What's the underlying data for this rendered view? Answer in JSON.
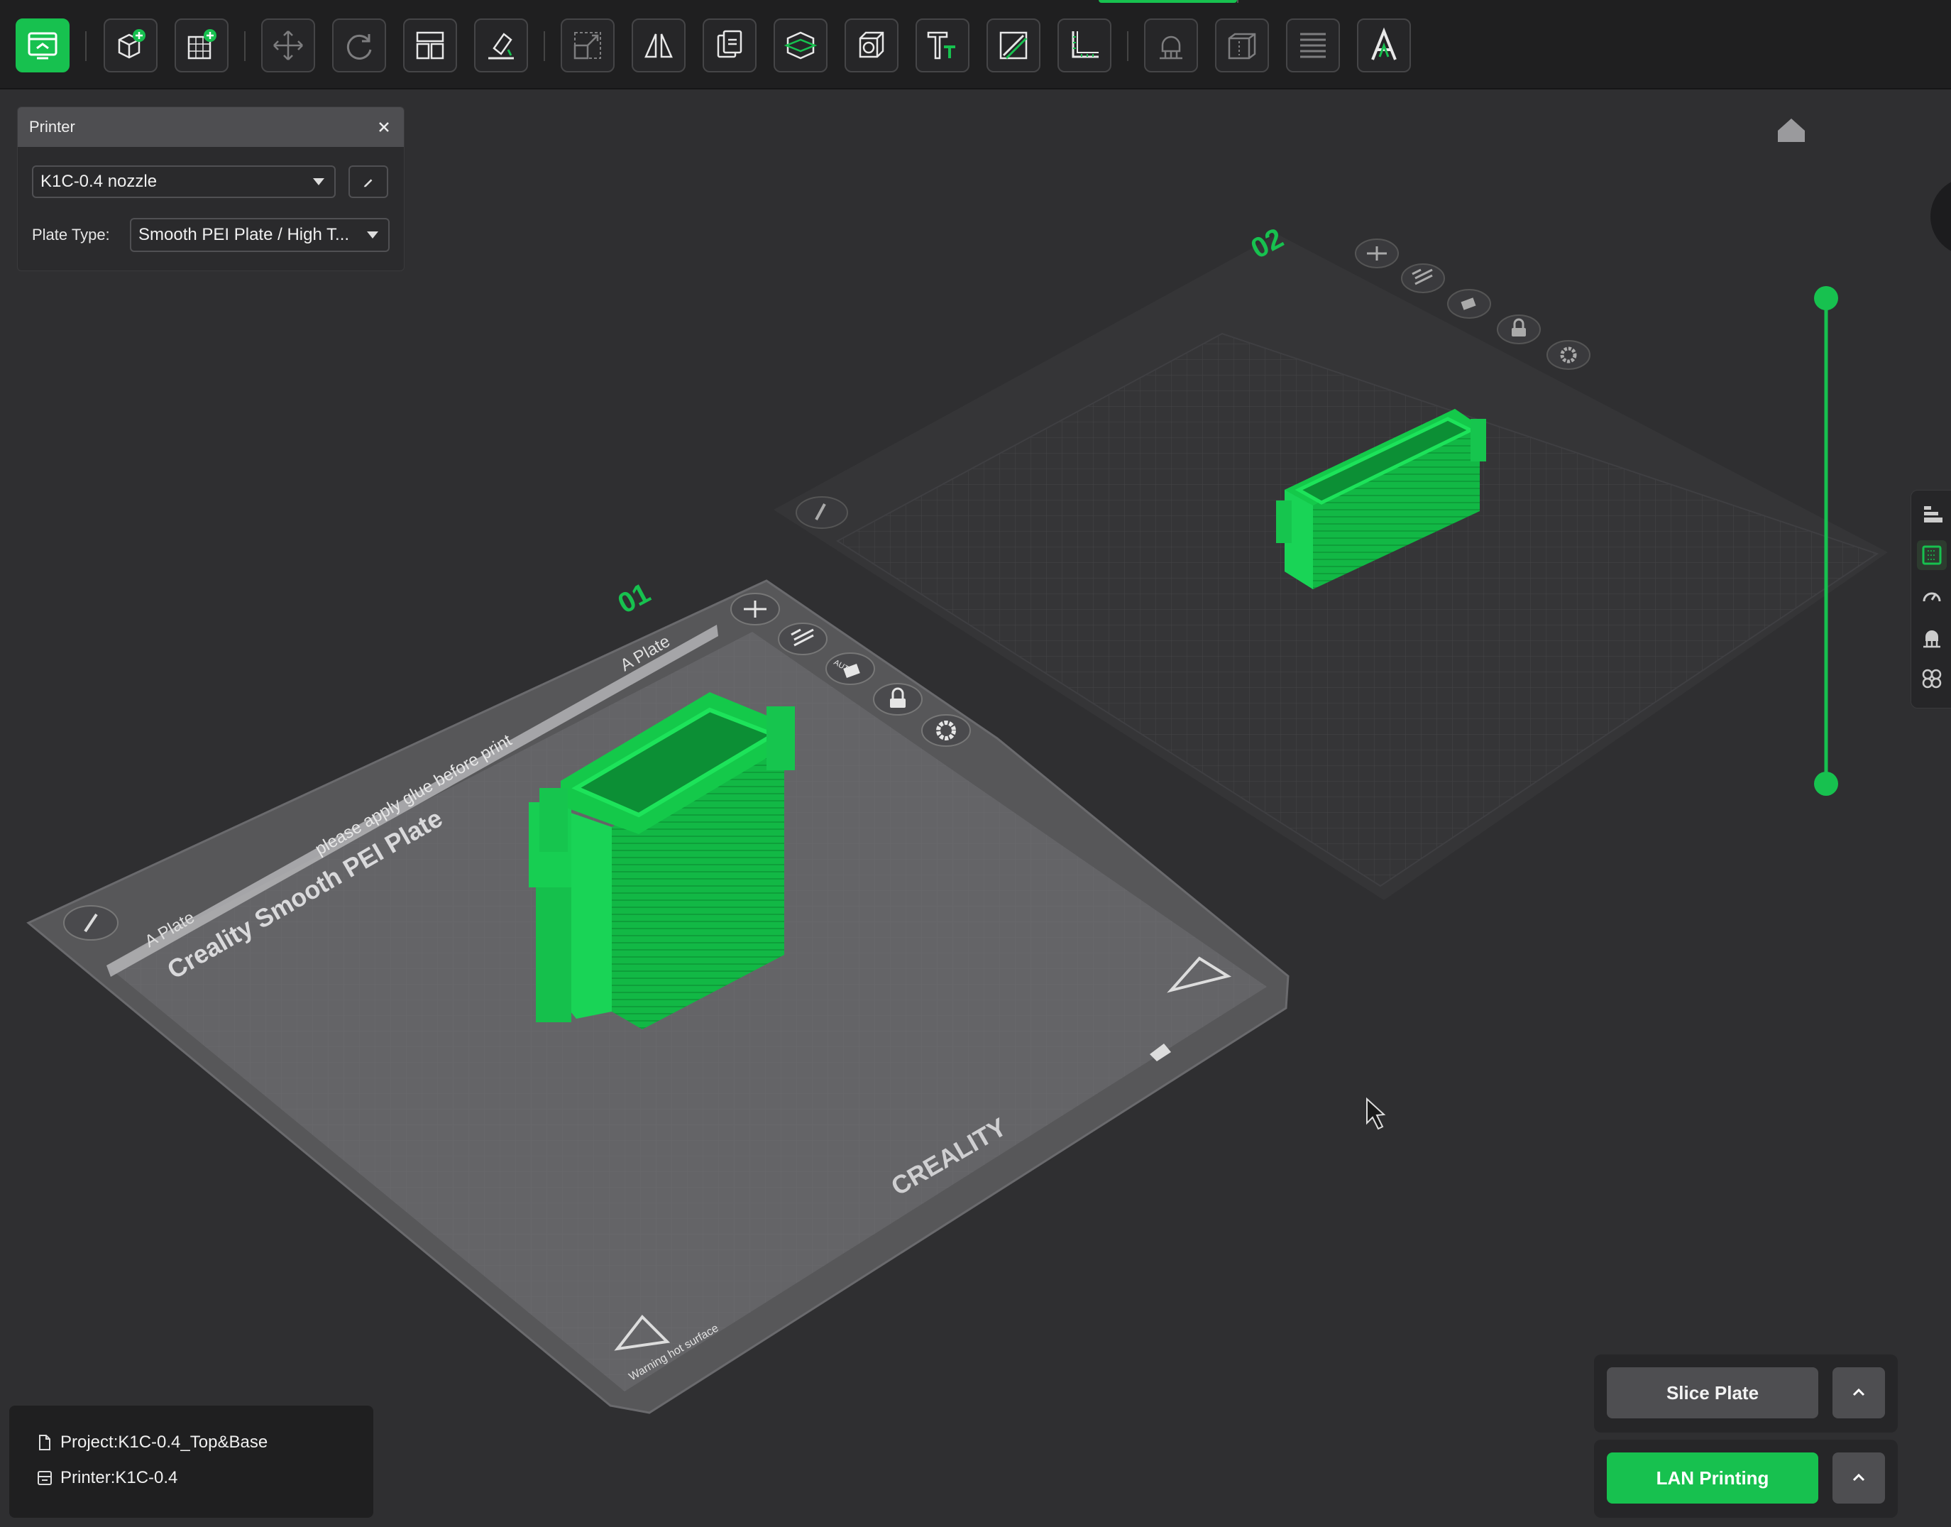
{
  "toolbar": {
    "buttons": [
      {
        "name": "prepare-view-button",
        "icon": "monitor-icon",
        "active": true
      },
      {
        "name": "add-object-button",
        "icon": "cube-add-icon"
      },
      {
        "name": "add-plate-button",
        "icon": "plate-add-icon"
      },
      {
        "name": "move-button",
        "icon": "move-icon",
        "dim": true
      },
      {
        "name": "rotate-button",
        "icon": "rotate-icon",
        "dim": true
      },
      {
        "name": "arrange-button",
        "icon": "arrange-icon"
      },
      {
        "name": "lay-on-face-button",
        "icon": "lay-on-face-icon"
      },
      {
        "name": "scale-button",
        "icon": "scale-icon",
        "dim": true
      },
      {
        "name": "mirror-button",
        "icon": "mirror-icon"
      },
      {
        "name": "clone-button",
        "icon": "clone-icon"
      },
      {
        "name": "cut-button",
        "icon": "cut-icon"
      },
      {
        "name": "hollow-button",
        "icon": "hollow-icon"
      },
      {
        "name": "text-button",
        "icon": "text-icon"
      },
      {
        "name": "split-button",
        "icon": "split-icon"
      },
      {
        "name": "measure-button",
        "icon": "measure-icon"
      },
      {
        "name": "support-paint-button",
        "icon": "support-paint-icon",
        "dim": true
      },
      {
        "name": "seam-paint-button",
        "icon": "seam-icon",
        "dim": true
      },
      {
        "name": "layers-button",
        "icon": "layers-icon",
        "dim": true
      },
      {
        "name": "assembly-text-button",
        "icon": "letter-a-icon"
      }
    ],
    "accent_color": "#17c14f"
  },
  "printer_panel": {
    "title": "Printer",
    "printer": "K1C-0.4 nozzle",
    "plate_type_label": "Plate Type:",
    "plate_type": "Smooth PEI Plate / High T..."
  },
  "plates": [
    {
      "number": "01",
      "plate_tab": "A Plate",
      "plate_tab_2": "A Plate",
      "brand_text": "Creality Smooth PEI Plate",
      "hint_text": "please apply glue before print",
      "logo_text": "CREALITY",
      "warning_text": "Warning hot surface"
    },
    {
      "number": "02"
    }
  ],
  "plate_controls": [
    "add-icon",
    "arrange-icon",
    "auto-orient-icon",
    "lock-icon",
    "settings-icon"
  ],
  "plate_control_auto": "AUTO",
  "info": {
    "project": "Project:K1C-0.4_Top&Base",
    "printer": "Printer:K1C-0.4"
  },
  "actions": {
    "slice": "Slice Plate",
    "print": "LAN Printing"
  },
  "colors": {
    "model_green": "#14c94a",
    "bed_gray": "#5a5a5d",
    "background": "#2f2f31"
  }
}
